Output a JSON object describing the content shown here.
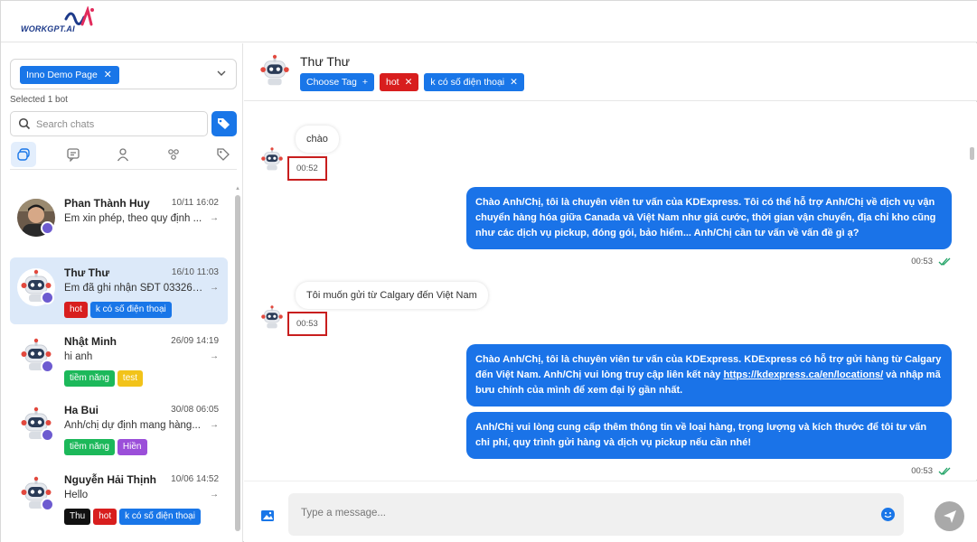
{
  "brand": {
    "logo_text": "WORKGPT.AI"
  },
  "sidebar": {
    "page_chip": "Inno Demo Page",
    "chip_close": "✕",
    "selected_note": "Selected 1 bot",
    "search_placeholder": "Search chats",
    "filters": [
      "all-chats",
      "messages",
      "user",
      "group",
      "tag"
    ],
    "conversations": [
      {
        "name": "Phan Thành Huy",
        "time": "10/11 16:02",
        "preview": "Em xin phép, theo quy định ...",
        "avatar": "photo",
        "tags": []
      },
      {
        "name": "Thư Thư",
        "time": "16/10 11:03",
        "preview": "Em đã ghi nhận SĐT 033267...",
        "avatar": "bot",
        "active": true,
        "tags": [
          {
            "label": "hot",
            "color": "#d81e1e"
          },
          {
            "label": "k có số điện thoại",
            "color": "#1976e8"
          }
        ]
      },
      {
        "name": "Nhật Minh",
        "time": "26/09 14:19",
        "preview": "hi anh",
        "avatar": "bot",
        "tags": [
          {
            "label": "tiềm năng",
            "color": "#1cb85a"
          },
          {
            "label": "test",
            "color": "#f2c31a"
          }
        ]
      },
      {
        "name": "Ha Bui",
        "time": "30/08 06:05",
        "preview": "Anh/chị dự định mang hàng...",
        "avatar": "bot",
        "tags": [
          {
            "label": "tiềm năng",
            "color": "#1cb85a"
          },
          {
            "label": "Hiền",
            "color": "#9b4fd9"
          }
        ]
      },
      {
        "name": "Nguyễn Hải Thịnh",
        "time": "10/06 14:52",
        "preview": "Hello",
        "avatar": "bot",
        "tags": [
          {
            "label": "Thu",
            "color": "#111111"
          },
          {
            "label": "hot",
            "color": "#d81e1e"
          },
          {
            "label": "k có số điện thoại",
            "color": "#1976e8"
          }
        ]
      }
    ]
  },
  "chat": {
    "title": "Thư Thư",
    "header_tags": [
      {
        "label": "Choose Tag",
        "suffix": "+",
        "color": "#1976e8"
      },
      {
        "label": "hot",
        "suffix": "✕",
        "color": "#d81e1e"
      },
      {
        "label": "k có số điện thoại",
        "suffix": "✕",
        "color": "#1976e8"
      }
    ],
    "messages": {
      "in1": {
        "text": "chào",
        "time": "00:52"
      },
      "out1": {
        "text": "Chào Anh/Chị, tôi là chuyên viên tư vấn của KDExpress. Tôi có thể hỗ trợ Anh/Chị về dịch vụ vận chuyển hàng hóa giữa Canada và Việt Nam như giá cước, thời gian vận chuyển, địa chỉ kho cũng như các dịch vụ pickup, đóng gói, bảo hiểm... Anh/Chị cần tư vấn về vấn đề gì ạ?",
        "time": "00:53"
      },
      "in2": {
        "text": "Tôi muốn gửi từ Calgary đến Việt Nam",
        "time": "00:53"
      },
      "out2": {
        "text_before": "Chào Anh/Chị, tôi là chuyên viên tư vấn của KDExpress. KDExpress có hỗ trợ gửi hàng từ Calgary đến Việt Nam. Anh/Chị vui lòng truy cập liên kết này ",
        "link": "https://kdexpress.ca/en/locations/",
        "text_after": " và nhập mã bưu chính của mình để xem đại lý gần nhất."
      },
      "out3": {
        "text": "Anh/Chị vui lòng cung cấp thêm thông tin về loại hàng, trọng lượng và kích thước để tôi tư vấn chi phí, quy trình gửi hàng và dịch vụ pickup nếu cần nhé!",
        "time": "00:53"
      }
    },
    "composer_placeholder": "Type a message..."
  },
  "colors": {
    "accent": "#1976e8",
    "outgoing_bubble": "#1a73e8",
    "highlight_box": "#c81e1e",
    "active_row": "#dce9f9"
  }
}
